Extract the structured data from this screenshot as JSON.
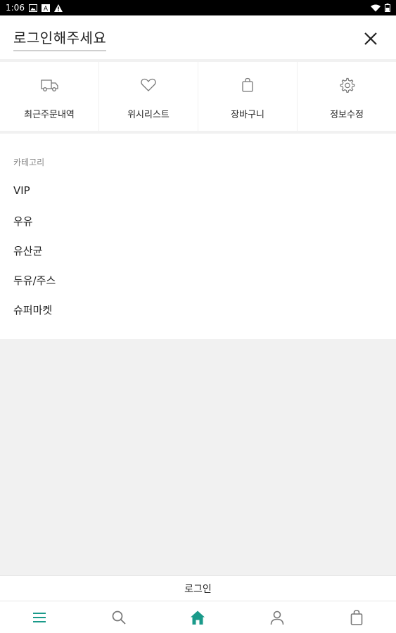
{
  "status_bar": {
    "time": "1:06"
  },
  "header": {
    "title": "로그인해주세요",
    "close_icon": "close-icon"
  },
  "quick_menu": [
    {
      "label": "최근주문내역",
      "icon": "truck-icon"
    },
    {
      "label": "위시리스트",
      "icon": "heart-icon"
    },
    {
      "label": "장바구니",
      "icon": "shopping-bag-icon"
    },
    {
      "label": "정보수정",
      "icon": "gear-icon"
    }
  ],
  "categories": {
    "heading": "카테고리",
    "items": [
      "VIP",
      "우유",
      "유산균",
      "두유/주스",
      "슈퍼마켓"
    ]
  },
  "bottom": {
    "login_label": "로그인"
  },
  "tab_bar": [
    {
      "icon": "menu-icon",
      "active": false
    },
    {
      "icon": "search-icon",
      "active": false
    },
    {
      "icon": "home-icon",
      "active": true
    },
    {
      "icon": "user-icon",
      "active": false
    },
    {
      "icon": "cart-bag-icon",
      "active": false
    }
  ],
  "colors": {
    "accent": "#1a9a8a",
    "icon_gray": "#777777"
  }
}
